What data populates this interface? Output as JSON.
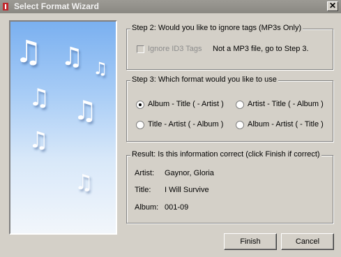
{
  "window": {
    "title": "Select Format Wizard",
    "close_glyph": "✕"
  },
  "step2": {
    "legend": "Step 2: Would you like to ignore tags (MP3s Only)",
    "checkbox_label": "Ignore ID3 Tags",
    "checkbox_checked": false,
    "checkbox_enabled": false,
    "note": "Not a MP3 file, go to Step 3."
  },
  "step3": {
    "legend": "Step 3: Which format would you like to use",
    "options": [
      {
        "label": "Album - Title ( - Artist )",
        "selected": true
      },
      {
        "label": "Artist - Title ( - Album )",
        "selected": false
      },
      {
        "label": "Title - Artist ( - Album )",
        "selected": false
      },
      {
        "label": "Album - Artist ( - Title )",
        "selected": false
      }
    ]
  },
  "result": {
    "legend": "Result: Is this information correct (click Finish if correct)",
    "rows": [
      {
        "label": "Artist:",
        "value": "Gaynor, Gloria"
      },
      {
        "label": "Title:",
        "value": "I Will Survive"
      },
      {
        "label": "Album:",
        "value": "001-09"
      }
    ]
  },
  "buttons": {
    "finish": "Finish",
    "cancel": "Cancel"
  },
  "decor": {
    "note_glyph": "♫",
    "app_icon_color": "#c0282d",
    "panel_accent": "#7ab0f0"
  }
}
